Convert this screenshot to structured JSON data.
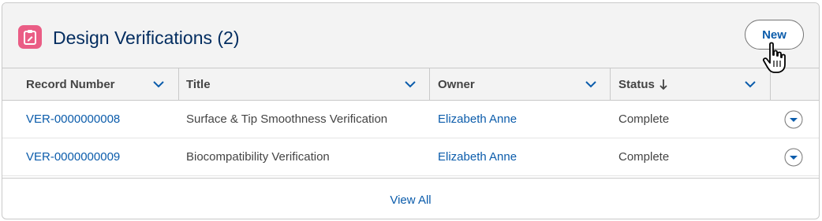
{
  "card": {
    "title": "Design Verifications (2)",
    "icon": "clipboard-edit-icon",
    "accent_color": "#ea5d85",
    "new_button_label": "New"
  },
  "table": {
    "columns": [
      {
        "label": "Record Number",
        "sortable_menu": true
      },
      {
        "label": "Title",
        "sortable_menu": true
      },
      {
        "label": "Owner",
        "sortable_menu": true
      },
      {
        "label": "Status",
        "sort_direction": "descending",
        "sortable_menu": true
      }
    ],
    "rows": [
      {
        "record_number": "VER-0000000008",
        "title": "Surface & Tip Smoothness Verification",
        "owner": "Elizabeth Anne",
        "status": "Complete"
      },
      {
        "record_number": "VER-0000000009",
        "title": "Biocompatibility Verification",
        "owner": "Elizabeth Anne",
        "status": "Complete"
      }
    ]
  },
  "footer": {
    "view_all_label": "View All"
  },
  "colors": {
    "link": "#0b5cab",
    "title": "#032d60",
    "header_bg": "#f3f3f3"
  }
}
